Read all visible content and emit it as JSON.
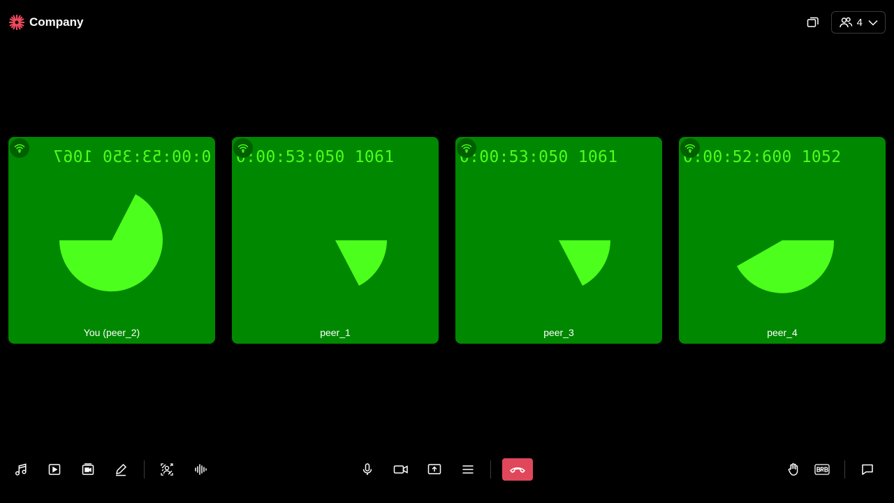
{
  "header": {
    "logo_text": "Company",
    "participant_count": "4"
  },
  "colors": {
    "tile_background": "#008800",
    "pie_fill": "#4cff1c",
    "timer_text": "#4cff1c",
    "leave_button": "#e0475b",
    "logo_accent": "#ef4b5e"
  },
  "tiles": [
    {
      "name": "You (peer_2)",
      "timer": "0:00:53:350 1067",
      "mirrored": true
    },
    {
      "name": "peer_1",
      "timer": "0:00:53:050 1061",
      "mirrored": false
    },
    {
      "name": "peer_3",
      "timer": "0:00:53:050 1061",
      "mirrored": false
    },
    {
      "name": "peer_4",
      "timer": "0:00:52:600 1052",
      "mirrored": false
    }
  ],
  "toolbar": {
    "left": [
      "music-icon",
      "video-play-icon",
      "media-share-icon",
      "whiteboard-pen-icon",
      "virtual-background-icon",
      "noise-suppression-icon"
    ],
    "center": [
      "microphone-icon",
      "camera-icon",
      "screen-share-icon",
      "more-menu-icon",
      "leave-call-icon"
    ],
    "right": [
      "raise-hand-icon",
      "brb-icon",
      "chat-icon"
    ]
  }
}
